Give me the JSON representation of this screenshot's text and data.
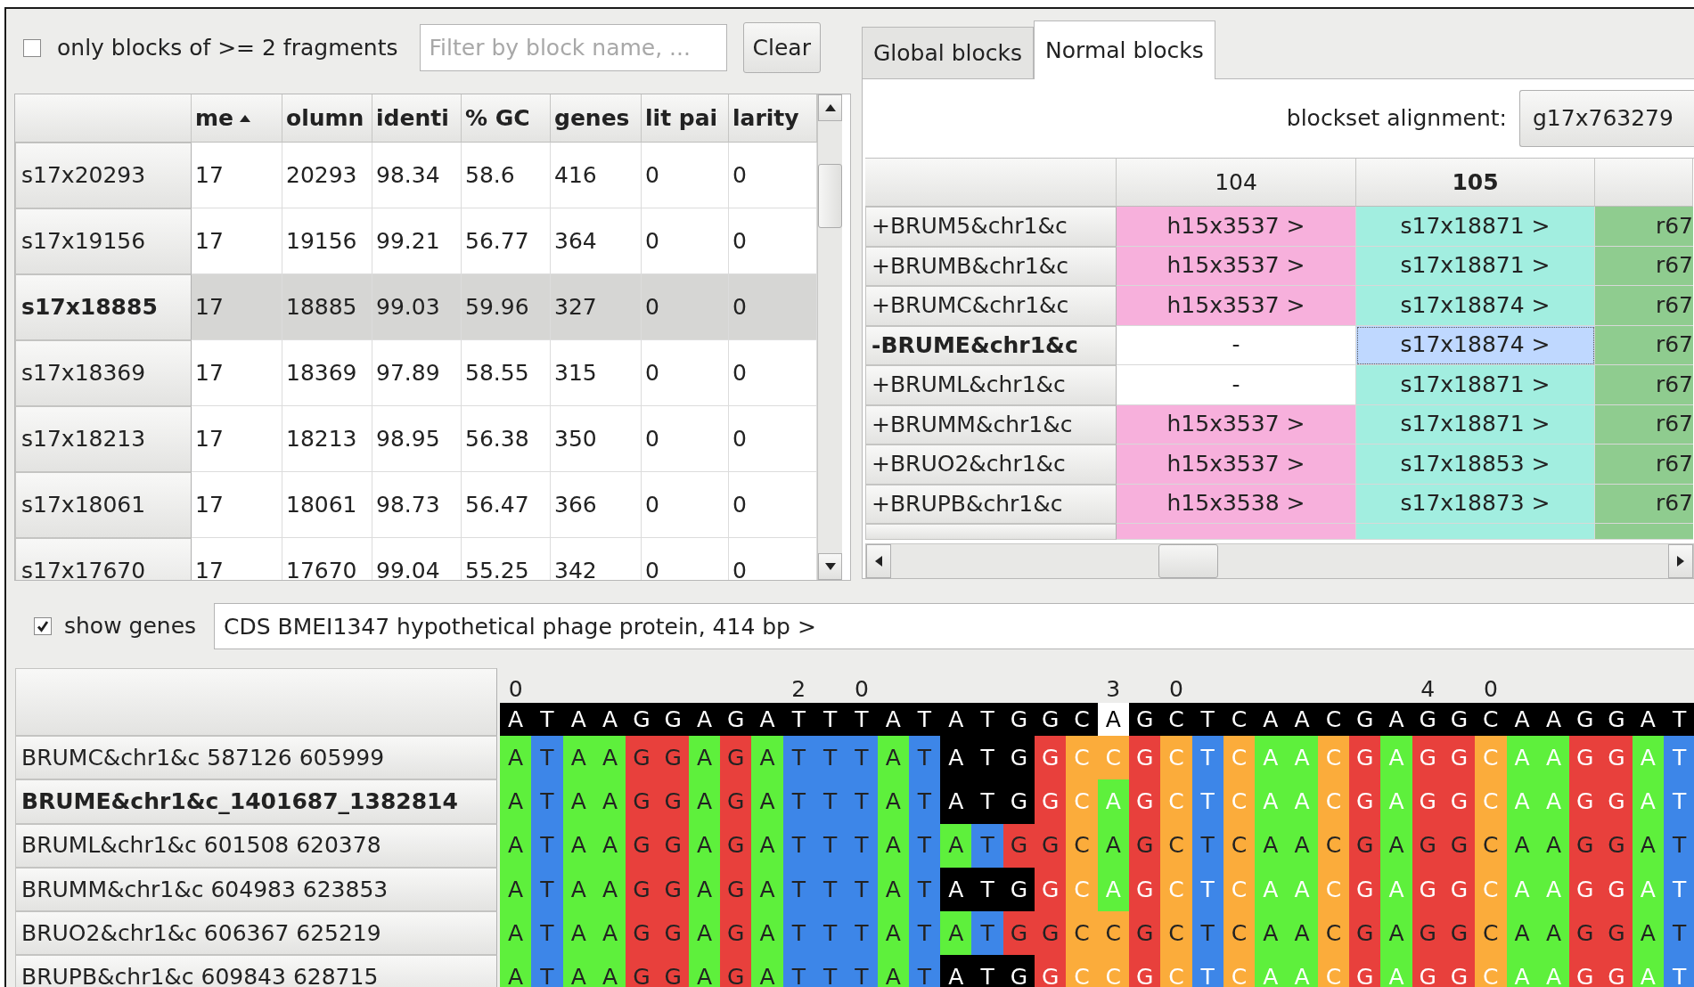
{
  "filter_bar": {
    "fragments_filter": {
      "label": "only blocks of >= 2 fragments",
      "checked": false
    },
    "filter": {
      "placeholder": "Filter by block name, ..."
    },
    "clear_button": "Clear"
  },
  "blocks_table": {
    "columns": [
      {
        "label": "me",
        "sorted": true
      },
      {
        "label": "olumn",
        "sorted": false
      },
      {
        "label": "identi",
        "sorted": false
      },
      {
        "label": "% GC",
        "sorted": false
      },
      {
        "label": "genes",
        "sorted": false
      },
      {
        "label": "lit pai",
        "sorted": false
      },
      {
        "label": "larity",
        "sorted": false
      }
    ],
    "rows": [
      {
        "name": "s17x20293",
        "selected": false,
        "cells": [
          "17",
          "20293",
          "98.34",
          "58.6",
          "416",
          "0",
          "0"
        ]
      },
      {
        "name": "s17x19156",
        "selected": false,
        "cells": [
          "17",
          "19156",
          "99.21",
          "56.77",
          "364",
          "0",
          "0"
        ]
      },
      {
        "name": "s17x18885",
        "selected": true,
        "cells": [
          "17",
          "18885",
          "99.03",
          "59.96",
          "327",
          "0",
          "0"
        ]
      },
      {
        "name": "s17x18369",
        "selected": false,
        "cells": [
          "17",
          "18369",
          "97.89",
          "58.55",
          "315",
          "0",
          "0"
        ]
      },
      {
        "name": "s17x18213",
        "selected": false,
        "cells": [
          "17",
          "18213",
          "98.95",
          "56.38",
          "350",
          "0",
          "0"
        ]
      },
      {
        "name": "s17x18061",
        "selected": false,
        "cells": [
          "17",
          "18061",
          "98.73",
          "56.47",
          "366",
          "0",
          "0"
        ]
      },
      {
        "name": "s17x17670",
        "selected": false,
        "cells": [
          "17",
          "17670",
          "99.04",
          "55.25",
          "342",
          "0",
          "0"
        ]
      }
    ]
  },
  "tabs": [
    {
      "label": "Global blocks",
      "selected": false
    },
    {
      "label": "Normal blocks",
      "selected": true
    }
  ],
  "blockset_alignment": {
    "label": "blockset alignment:",
    "value": "g17x763279"
  },
  "blockset_table": {
    "columns": [
      {
        "label": "104",
        "current": false,
        "kind": "full"
      },
      {
        "label": "105",
        "current": true,
        "kind": "full"
      },
      {
        "kind": "cut"
      }
    ],
    "rows": [
      {
        "label": "+BRUM5&chr1&c",
        "current": false,
        "cells": [
          {
            "text": "h15x3537 >",
            "color": "#f7b0dc",
            "selected": false
          },
          {
            "text": "s17x18871 >",
            "color": "#a2eee0",
            "selected": false
          },
          {
            "text": "r67",
            "color": "#8fcc8f",
            "selected": false
          }
        ]
      },
      {
        "label": "+BRUMB&chr1&c",
        "current": false,
        "cells": [
          {
            "text": "h15x3537 >",
            "color": "#f7b0dc",
            "selected": false
          },
          {
            "text": "s17x18871 >",
            "color": "#a2eee0",
            "selected": false
          },
          {
            "text": "r67",
            "color": "#8fcc8f",
            "selected": false
          }
        ]
      },
      {
        "label": "+BRUMC&chr1&c",
        "current": false,
        "cells": [
          {
            "text": "h15x3537 >",
            "color": "#f7b0dc",
            "selected": false
          },
          {
            "text": "s17x18874 >",
            "color": "#a2eee0",
            "selected": false
          },
          {
            "text": "r67",
            "color": "#8fcc8f",
            "selected": false
          }
        ]
      },
      {
        "label": "-BRUME&chr1&c",
        "current": true,
        "cells": [
          {
            "text": "-",
            "color": "#ffffff",
            "selected": false
          },
          {
            "text": "s17x18874 >",
            "color": "#bfd8ff",
            "selected": true
          },
          {
            "text": "r67",
            "color": "#8fcc8f",
            "selected": false
          }
        ]
      },
      {
        "label": "+BRUML&chr1&c",
        "current": false,
        "cells": [
          {
            "text": "-",
            "color": "#ffffff",
            "selected": false
          },
          {
            "text": "s17x18871 >",
            "color": "#a2eee0",
            "selected": false
          },
          {
            "text": "r67",
            "color": "#8fcc8f",
            "selected": false
          }
        ]
      },
      {
        "label": "+BRUMM&chr1&c",
        "current": false,
        "cells": [
          {
            "text": "h15x3537 >",
            "color": "#f7b0dc",
            "selected": false
          },
          {
            "text": "s17x18871 >",
            "color": "#a2eee0",
            "selected": false
          },
          {
            "text": "r67",
            "color": "#8fcc8f",
            "selected": false
          }
        ]
      },
      {
        "label": "+BRUO2&chr1&c",
        "current": false,
        "cells": [
          {
            "text": "h15x3537 >",
            "color": "#f7b0dc",
            "selected": false
          },
          {
            "text": "s17x18853 >",
            "color": "#a2eee0",
            "selected": false
          },
          {
            "text": "r67",
            "color": "#8fcc8f",
            "selected": false
          }
        ]
      },
      {
        "label": "+BRUPB&chr1&c",
        "current": false,
        "cells": [
          {
            "text": "h15x3538 >",
            "color": "#f7b0dc",
            "selected": false
          },
          {
            "text": "s17x18873 >",
            "color": "#a2eee0",
            "selected": false
          },
          {
            "text": "r67",
            "color": "#8fcc8f",
            "selected": false
          }
        ]
      },
      {
        "cells": [
          {
            "color": "#f7b0dc",
            "selected": false
          },
          {
            "color": "#a2eee0",
            "selected": false
          },
          {
            "color": "#8fcc8f",
            "selected": false
          }
        ]
      }
    ]
  },
  "genes": {
    "show_genes": {
      "label": "show genes",
      "checked": true
    },
    "description": "CDS BMEI1347 hypothetical phage protein, 414 bp >"
  },
  "alignment": {
    "ruler": [
      "0",
      "2 0",
      "3 0",
      "4 0"
    ],
    "consensus": [
      {
        "kind": "consensus",
        "bases": "A T A A G G A G A T T T A T A T G G C"
      },
      {
        "kind": "selected",
        "bases": "A"
      },
      {
        "kind": "consensus",
        "bases": "G C T C A A C G A G G C A A G G A T"
      }
    ],
    "rows": [
      {
        "label": "BRUMC&chr1&c 587126 605999",
        "selected": false,
        "segments": [
          {
            "kind": "plain",
            "bases": "A T A A G G A G A T T T A T"
          },
          {
            "kind": "start_codon",
            "bases": "A T G"
          },
          {
            "kind": "gene",
            "bases": "G C C G C T C A A C G A G G C A A G G A T"
          }
        ]
      },
      {
        "label": "BRUME&chr1&c_1401687_1382814",
        "selected": true,
        "segments": [
          {
            "kind": "plain",
            "bases": "A T A A G G A G A T T T A T"
          },
          {
            "kind": "start_codon",
            "bases": "A T G"
          },
          {
            "kind": "gene",
            "bases": "G C A G C T C A A C G A G G C A A G G A T"
          }
        ]
      },
      {
        "label": "BRUML&chr1&c 601508 620378",
        "selected": false,
        "segments": [
          {
            "kind": "plain",
            "bases": "A T A A G G A G A T T T A T A T G G C A G C T C A A C G A G G C A A G G A T"
          }
        ]
      },
      {
        "label": "BRUMM&chr1&c 604983 623853",
        "selected": false,
        "segments": [
          {
            "kind": "plain",
            "bases": "A T A A G G A G A T T T A T"
          },
          {
            "kind": "start_codon",
            "bases": "A T G"
          },
          {
            "kind": "gene",
            "bases": "G C A G C T C A A C G A G G C A A G G A T"
          }
        ]
      },
      {
        "label": "BRUO2&chr1&c 606367 625219",
        "selected": false,
        "segments": [
          {
            "kind": "plain",
            "bases": "A T A A G G A G A T T T A T A T G G C C G C T C A A C G A G G C A A G G A T"
          }
        ]
      },
      {
        "label": "BRUPB&chr1&c 609843 628715",
        "selected": false,
        "segments": [
          {
            "kind": "plain",
            "bases": "A T A A G G A G A T T T A T"
          },
          {
            "kind": "start_codon",
            "bases": "A T G"
          },
          {
            "kind": "gene",
            "bases": "G C C G C T C A A C G A G G C A A G G A T"
          }
        ]
      }
    ]
  }
}
